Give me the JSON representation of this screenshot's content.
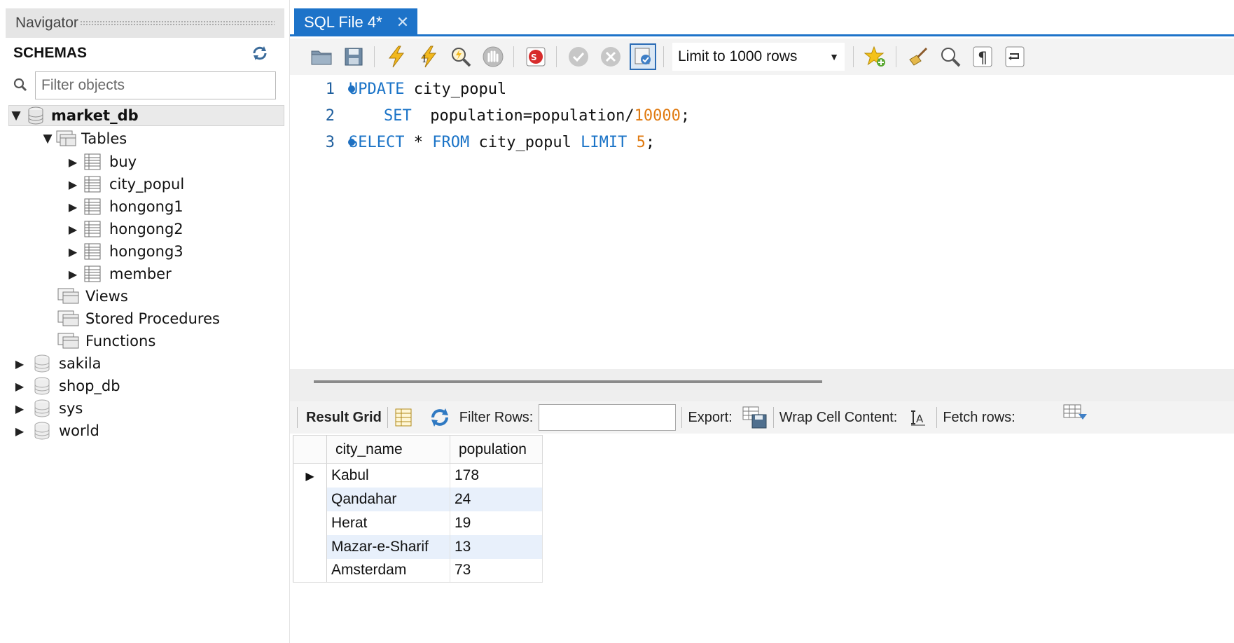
{
  "navigator": {
    "header_title": "Navigator",
    "schemas_title": "SCHEMAS",
    "filter_placeholder": "Filter objects",
    "tree": {
      "market_db": {
        "label": "market_db",
        "tables_label": "Tables",
        "tables": [
          "buy",
          "city_popul",
          "hongong1",
          "hongong2",
          "hongong3",
          "member"
        ],
        "views_label": "Views",
        "procedures_label": "Stored Procedures",
        "functions_label": "Functions"
      },
      "other_schemas": [
        "sakila",
        "shop_db",
        "sys",
        "world"
      ]
    }
  },
  "editor": {
    "tab_label": "SQL File 4*",
    "limit_label": "Limit to 1000 rows",
    "lines": [
      {
        "num": "1",
        "kw1": "UPDATE",
        "rest": " city_popul"
      },
      {
        "num": "2",
        "kw1": "SET",
        "rest": "  population=population/",
        "number": "10000",
        "tail": ";"
      },
      {
        "num": "3",
        "kw1": "SELECT",
        "mid1": " * ",
        "kw2": "FROM",
        "mid2": " city_popul ",
        "kw3": "LIMIT",
        "mid3": " ",
        "number": "5",
        "tail": ";"
      }
    ]
  },
  "result": {
    "result_grid_label": "Result Grid",
    "filter_rows_label": "Filter Rows:",
    "export_label": "Export:",
    "wrap_label": "Wrap Cell Content:",
    "fetch_label": "Fetch rows:",
    "columns": [
      "city_name",
      "population"
    ],
    "rows": [
      [
        "Kabul",
        "178"
      ],
      [
        "Qandahar",
        "24"
      ],
      [
        "Herat",
        "19"
      ],
      [
        "Mazar-e-Sharif",
        "13"
      ],
      [
        "Amsterdam",
        "73"
      ]
    ]
  },
  "colors": {
    "accent": "#1d73c9",
    "keyword": "#1a73c7",
    "number": "#e07a10",
    "alt_row": "#e8f0fb"
  }
}
